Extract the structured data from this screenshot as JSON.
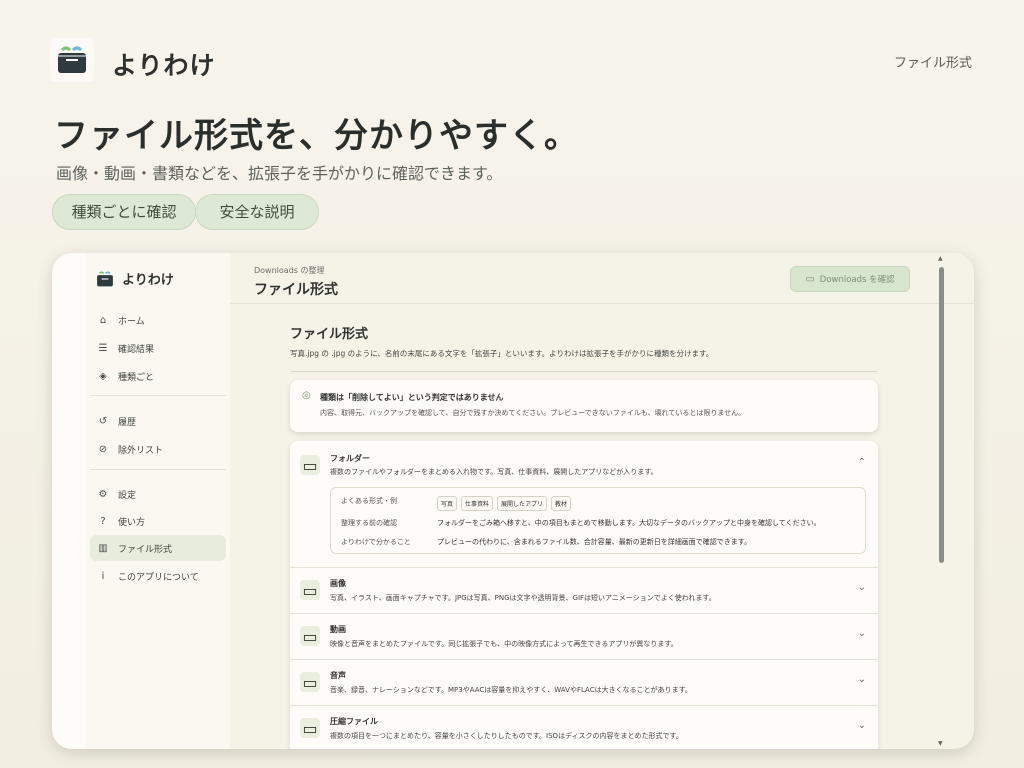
{
  "header": {
    "brand": "よりわけ",
    "link": "ファイル形式"
  },
  "hero": {
    "title": "ファイル形式を、分かりやすく。",
    "subtitle": "画像・動画・書類などを、拡張子を手がかりに確認できます。",
    "pills": [
      "種類ごとに確認",
      "安全な説明"
    ]
  },
  "app": {
    "brand": "よりわけ",
    "nav": [
      {
        "label": "ホーム",
        "icon": "home-icon",
        "glyph": "⌂"
      },
      {
        "label": "確認結果",
        "icon": "filter-lines-icon",
        "glyph": "☰"
      },
      {
        "label": "種類ごと",
        "icon": "box-icon",
        "glyph": "◈"
      },
      {
        "label": "履歴",
        "icon": "history-icon",
        "glyph": "↺"
      },
      {
        "label": "除外リスト",
        "icon": "ban-icon",
        "glyph": "⊘"
      },
      {
        "label": "設定",
        "icon": "sliders-icon",
        "glyph": "⚙"
      },
      {
        "label": "使い方",
        "icon": "help-icon",
        "glyph": "?"
      },
      {
        "label": "ファイル形式",
        "icon": "book-icon",
        "glyph": "▥"
      },
      {
        "label": "このアプリについて",
        "icon": "info-icon",
        "glyph": "i"
      }
    ],
    "breadcrumb": "Downloads の整理",
    "title": "ファイル形式",
    "action_button": "Downloads を確認",
    "section_title": "ファイル形式",
    "section_desc": "写真.jpg の .jpg のように、名前の末尾にある文字を「拡張子」といいます。よりわけは拡張子を手がかりに種類を分けます。",
    "notice": {
      "title": "種類は「削除してよい」という判定ではありません",
      "text": "内容、取得元、バックアップを確認して、自分で残すか決めてください。プレビューできないファイルも、壊れているとは限りません。"
    },
    "types": [
      {
        "name": "フォルダー",
        "desc": "複数のファイルやフォルダーをまとめる入れ物です。写真、仕事資料、展開したアプリなどが入ります。",
        "expanded": true,
        "details": {
          "examples_label": "よくある形式・例",
          "examples": [
            "写真",
            "仕事資料",
            "展開したアプリ",
            "教材"
          ],
          "check_label": "整理する前の確認",
          "check_text": "フォルダーをごみ箱へ移すと、中の項目もまとめて移動します。大切なデータのバックアップと中身を確認してください。",
          "learn_label": "よりわけで分かること",
          "learn_text": "プレビューの代わりに、含まれるファイル数、合計容量、最新の更新日を詳細画面で確認できます。"
        }
      },
      {
        "name": "画像",
        "desc": "写真、イラスト、画面キャプチャです。JPGは写真、PNGは文字や透明背景、GIFは短いアニメーションでよく使われます。",
        "expanded": false
      },
      {
        "name": "動画",
        "desc": "映像と音声をまとめたファイルです。同じ拡張子でも、中の映像方式によって再生できるアプリが異なります。",
        "expanded": false
      },
      {
        "name": "音声",
        "desc": "音楽、録音、ナレーションなどです。MP3やAACは容量を抑えやすく、WAVやFLACは大きくなることがあります。",
        "expanded": false
      },
      {
        "name": "圧縮ファイル",
        "desc": "複数の項目を一つにまとめたり、容量を小さくしたりしたものです。ISOはディスクの内容をまとめた形式です。",
        "expanded": false
      }
    ]
  }
}
